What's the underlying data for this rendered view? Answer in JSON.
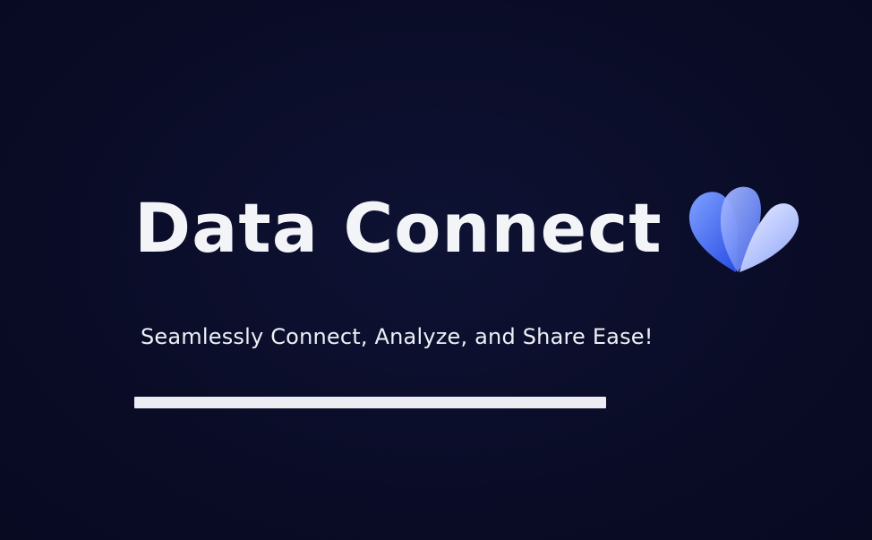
{
  "hero": {
    "title": "Data Connect",
    "subtitle": "Seamlessly Connect, Analyze, and Share Ease!",
    "logo_icon": "heart-icon",
    "progress_percent": 100
  },
  "colors": {
    "background": "#0b0d2a",
    "text": "#f2f3f7",
    "logo_light": "#c9d2ff",
    "logo_mid": "#6d8dfa",
    "logo_dark": "#3457e8",
    "progress": "#ecedf2"
  }
}
